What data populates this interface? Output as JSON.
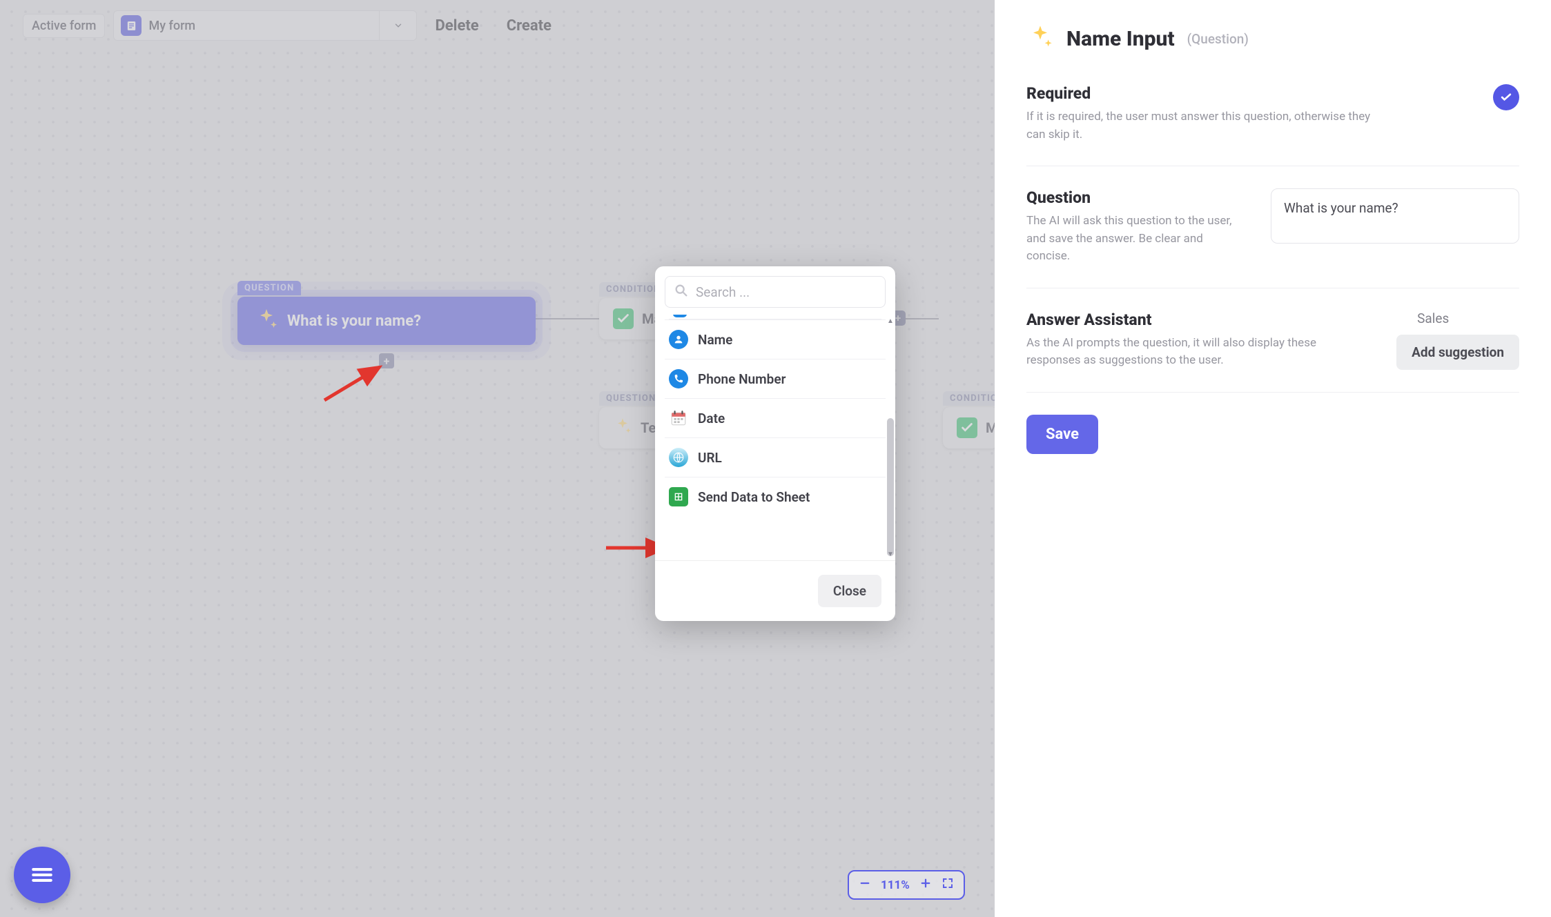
{
  "toolbar": {
    "active_label": "Active form",
    "form_name": "My form",
    "delete_label": "Delete",
    "create_label": "Create"
  },
  "nodes": {
    "main": {
      "tag": "QUESTION",
      "title": "What is your name?"
    },
    "cond1": {
      "tag": "CONDITION",
      "title": "Ma"
    },
    "cond2": {
      "tag": "CONDITION",
      "title": "M"
    },
    "q2": {
      "tag": "QUESTION",
      "title": "Te"
    }
  },
  "zoom": {
    "level": "111%"
  },
  "modal": {
    "search_placeholder": "Search ...",
    "options": [
      {
        "key": "name",
        "label": "Name",
        "icon": "user-icon",
        "color": "#1e88e5"
      },
      {
        "key": "phone",
        "label": "Phone Number",
        "icon": "phone-icon",
        "color": "#1e88e5"
      },
      {
        "key": "date",
        "label": "Date",
        "icon": "calendar-icon",
        "color": "#e06a6a"
      },
      {
        "key": "url",
        "label": "URL",
        "icon": "globe-icon",
        "color": "#2aa6d6"
      },
      {
        "key": "sheet",
        "label": "Send Data to Sheet",
        "icon": "sheet-icon",
        "color": "#2fa84f"
      }
    ],
    "close_label": "Close"
  },
  "panel": {
    "title": "Name Input",
    "subtitle": "(Question)",
    "required": {
      "title": "Required",
      "desc": "If it is required, the user must answer this question, otherwise they can skip it.",
      "value": true
    },
    "question": {
      "title": "Question",
      "desc": "The AI will ask this question to the user, and save the answer. Be clear and concise.",
      "value": "What is your name?"
    },
    "assist": {
      "title": "Answer Assistant",
      "desc": "As the AI prompts the question, it will also display these responses as suggestions to the user.",
      "suggestions": [
        "Sales"
      ],
      "add_label": "Add suggestion"
    },
    "save_label": "Save"
  }
}
